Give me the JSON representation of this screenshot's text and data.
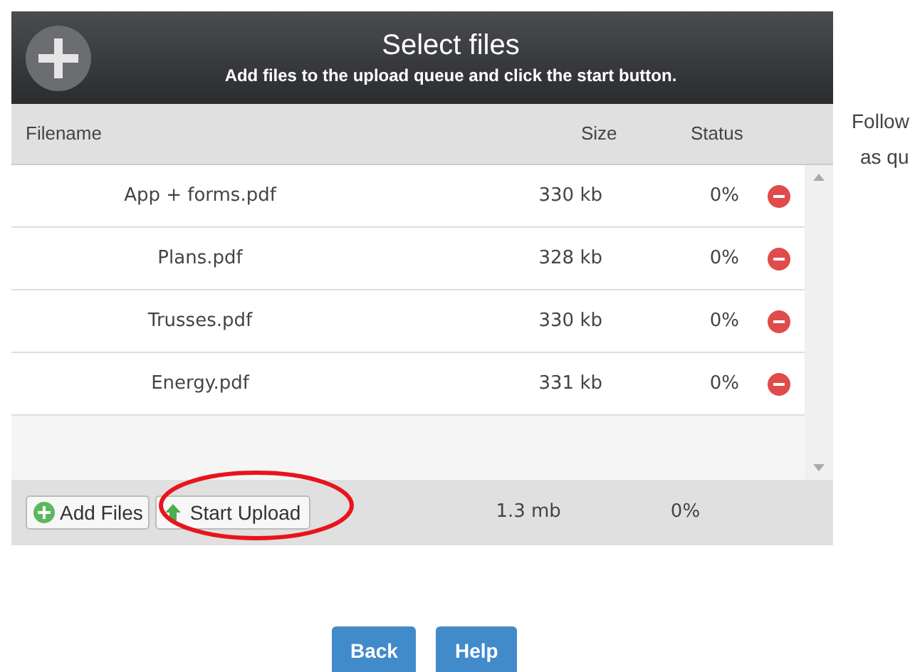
{
  "header": {
    "title": "Select files",
    "subtitle": "Add files to the upload queue and click the start button."
  },
  "columns": [
    "Filename",
    "Size",
    "Status"
  ],
  "rows": [
    {
      "filename": "App + forms.pdf",
      "size": "330 kb",
      "status": "0%"
    },
    {
      "filename": "Plans.pdf",
      "size": "328 kb",
      "status": "0%"
    },
    {
      "filename": "Trusses.pdf",
      "size": "330 kb",
      "status": "0%"
    },
    {
      "filename": "Energy.pdf",
      "size": "331 kb",
      "status": "0%"
    }
  ],
  "footer": {
    "add_button": "Add Files",
    "start_button": "Start Upload",
    "total_size": "1.3 mb",
    "total_status": "0%"
  },
  "side_note": [
    "Follow",
    "as qu"
  ],
  "buttons": [
    "Back",
    "Help"
  ]
}
